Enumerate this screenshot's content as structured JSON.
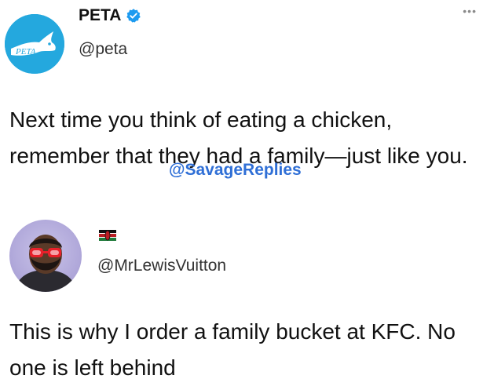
{
  "header": {
    "more_icon": "more-horizontal-icon",
    "more_glyph": "•••"
  },
  "original_tweet": {
    "account_name": "PETA",
    "handle": "@peta",
    "verified": true,
    "verified_color": "#1d9bf0",
    "avatar_color": "#24a8de",
    "avatar_logo_text": "PETA",
    "text": "Next time you think of eating a chicken, remember that they had a family—just like you."
  },
  "watermark": {
    "text": "@SavageReplies",
    "color": "#2f6fd6"
  },
  "reply_tweet": {
    "handle": "@MrLewisVuitton",
    "flag_icon": "kenya-flag-icon",
    "text": "This is why I order a family bucket at KFC. No one is left behind"
  }
}
